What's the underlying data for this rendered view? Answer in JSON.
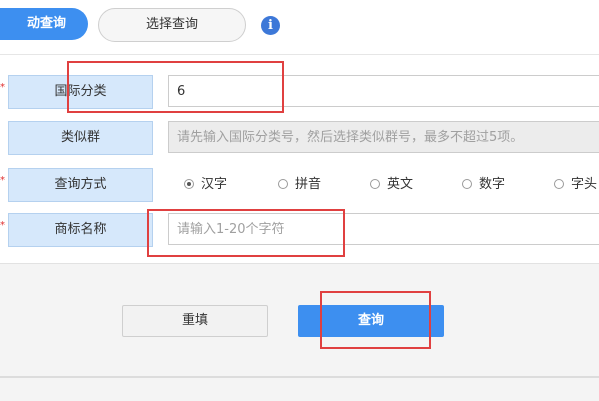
{
  "tabs": {
    "active_label": "动查询",
    "other_label": "选择查询"
  },
  "info_icon": "i",
  "form": {
    "required_mark": "*",
    "intl_class": {
      "label": "国际分类",
      "value": "6"
    },
    "similar_group": {
      "label": "类似群",
      "placeholder": "请先输入国际分类号，然后选择类似群号，最多不超过5项。"
    },
    "query_method": {
      "label": "查询方式",
      "options": [
        {
          "label": "汉字",
          "checked": true
        },
        {
          "label": "拼音",
          "checked": false
        },
        {
          "label": "英文",
          "checked": false
        },
        {
          "label": "数字",
          "checked": false
        },
        {
          "label": "字头",
          "checked": false
        }
      ]
    },
    "trademark_name": {
      "label": "商标名称",
      "placeholder": "请输入1-20个字符"
    }
  },
  "buttons": {
    "reset": "重填",
    "query": "查询"
  },
  "colors": {
    "accent": "#3d8ff0",
    "label_bg": "#d6e8fb",
    "highlight": "#e04040"
  }
}
